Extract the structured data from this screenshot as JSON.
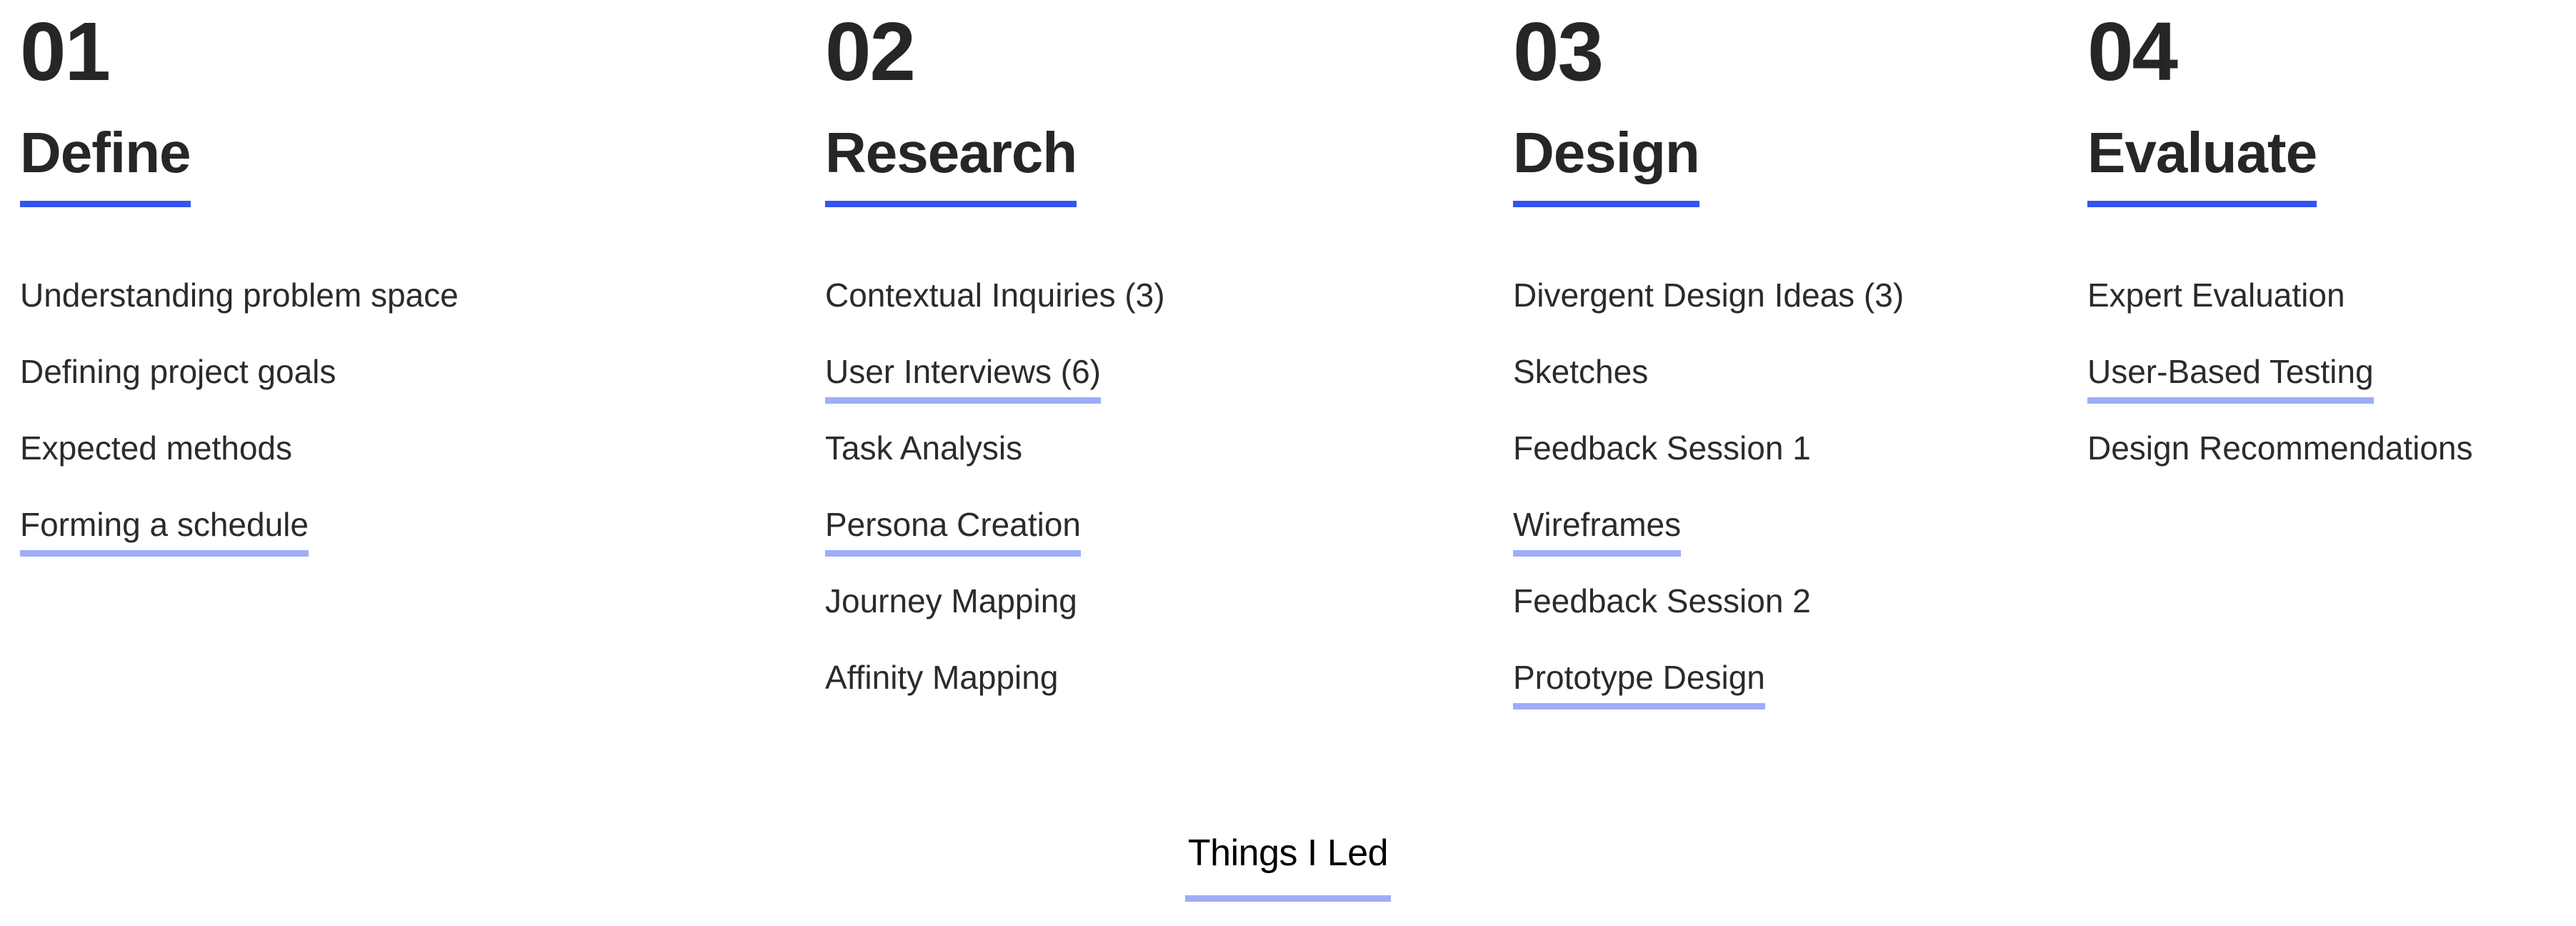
{
  "colors": {
    "header_rule": "#3355ee",
    "led_rule": "#9fadf7",
    "heading_text": "#262626",
    "body_text": "#2b2b2b",
    "legend_text": "#000000",
    "background": "#ffffff"
  },
  "columns": [
    {
      "number": "01",
      "title": "Define",
      "items": [
        {
          "label": "Understanding problem space",
          "led": false
        },
        {
          "label": "Defining project goals",
          "led": false
        },
        {
          "label": "Expected methods",
          "led": false
        },
        {
          "label": "Forming a schedule",
          "led": true
        }
      ]
    },
    {
      "number": "02",
      "title": "Research",
      "items": [
        {
          "label": "Contextual Inquiries (3)",
          "led": false
        },
        {
          "label": "User Interviews (6)",
          "led": true
        },
        {
          "label": "Task Analysis",
          "led": false
        },
        {
          "label": "Persona Creation",
          "led": true
        },
        {
          "label": "Journey Mapping",
          "led": false
        },
        {
          "label": "Affinity Mapping",
          "led": false
        }
      ]
    },
    {
      "number": "03",
      "title": "Design",
      "items": [
        {
          "label": "Divergent Design Ideas (3)",
          "led": false
        },
        {
          "label": "Sketches",
          "led": false
        },
        {
          "label": "Feedback Session 1",
          "led": false
        },
        {
          "label": "Wireframes",
          "led": true
        },
        {
          "label": "Feedback Session 2",
          "led": false
        },
        {
          "label": "Prototype Design",
          "led": true
        }
      ]
    },
    {
      "number": "04",
      "title": "Evaluate",
      "items": [
        {
          "label": "Expert Evaluation",
          "led": false
        },
        {
          "label": "User-Based Testing",
          "led": true
        },
        {
          "label": "Design Recommendations",
          "led": false
        }
      ]
    }
  ],
  "legend": {
    "label": "Things I Led"
  }
}
